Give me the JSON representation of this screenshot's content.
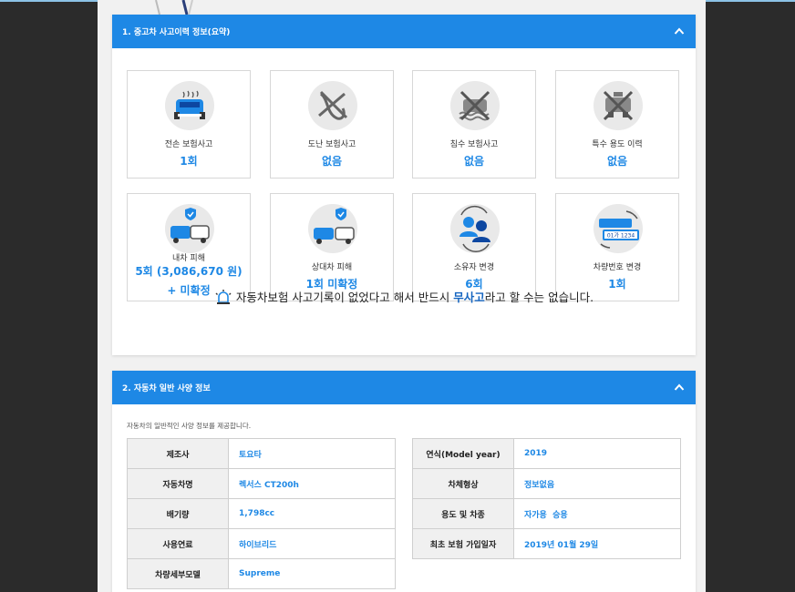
{
  "section1": {
    "title": "1. 중고차 사고이력 정보(요약)",
    "cards": [
      {
        "label": "전손 보험사고",
        "value": "1회",
        "icon": "total-loss-car-icon"
      },
      {
        "label": "도난 보험사고",
        "value": "없음",
        "icon": "theft-crossed-icon"
      },
      {
        "label": "침수 보험사고",
        "value": "없음",
        "icon": "flood-crossed-icon"
      },
      {
        "label": "특수 용도 이력",
        "value": "없음",
        "icon": "taxi-crossed-icon"
      },
      {
        "label": "내차 피해",
        "value": "5회 (3,086,670 원) + 미확정",
        "icon": "my-car-damage-icon"
      },
      {
        "label": "상대차 피해",
        "value": "1회 미확정",
        "icon": "other-car-damage-icon"
      },
      {
        "label": "소유자 변경",
        "value": "6회",
        "icon": "owner-change-icon"
      },
      {
        "label": "차량번호 변경",
        "value": "1회",
        "icon": "plate-change-icon",
        "plate_text": "01가 1234"
      }
    ],
    "notice": {
      "before": "자동차보험 사고기록이 없었다고 해서 반드시 ",
      "strong": "무사고",
      "after": "라고 할 수는 없습니다."
    }
  },
  "section2": {
    "title": "2. 자동차 일반 사양 정보",
    "description": "자동차의 일반적인 사양 정보를 제공합니다.",
    "left_rows": [
      {
        "key": "제조사",
        "value": "토요타"
      },
      {
        "key": "자동차명",
        "value": "렉서스 CT200h"
      },
      {
        "key": "배기량",
        "value": "1,798cc"
      },
      {
        "key": "사용연료",
        "value": "하이브리드"
      },
      {
        "key": "차량세부모델",
        "value": "Supreme"
      }
    ],
    "right_rows": [
      {
        "key": "연식(Model year)",
        "value": "2019"
      },
      {
        "key": "차체형상",
        "value": "정보없음"
      },
      {
        "key": "용도 및 차종",
        "value": "자가용  승용"
      },
      {
        "key": "최초 보험 가입일자",
        "value": "2019년 01월 29일"
      }
    ]
  },
  "colors": {
    "accent": "#1e88e5",
    "page_bg": "#f1f1f1",
    "dark_side": "#2b2b2b"
  }
}
